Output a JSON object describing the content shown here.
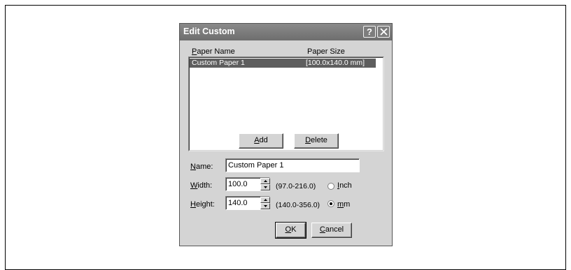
{
  "dialog": {
    "title": "Edit Custom",
    "help_label": "?",
    "columns": {
      "name_prefix": "P",
      "name_rest": "aper Name",
      "size": "Paper Size"
    },
    "list": [
      {
        "name": "Custom Paper 1",
        "size": "[100.0x140.0 mm]",
        "selected": true
      }
    ],
    "buttons": {
      "add_key": "A",
      "add_rest": "dd",
      "delete_key": "D",
      "delete_rest": "elete",
      "ok_key": "O",
      "ok_rest": "K",
      "cancel_key": "C",
      "cancel_rest": "ancel"
    },
    "name_field": {
      "label_key": "N",
      "label_rest": "ame:",
      "value": "Custom Paper 1"
    },
    "width_field": {
      "label_key": "W",
      "label_rest": "idth:",
      "value": "100.0",
      "range": "(97.0-216.0)"
    },
    "height_field": {
      "label_key": "H",
      "label_rest": "eight:",
      "value": "140.0",
      "range": "(140.0-356.0)"
    },
    "units": [
      {
        "key": "I",
        "rest": "nch",
        "checked": false
      },
      {
        "key": "m",
        "rest": "m",
        "checked": true
      }
    ]
  },
  "icons": {
    "help": "question-mark-icon",
    "close": "close-icon",
    "spin_up": "arrow-up-icon",
    "spin_down": "arrow-down-icon"
  }
}
